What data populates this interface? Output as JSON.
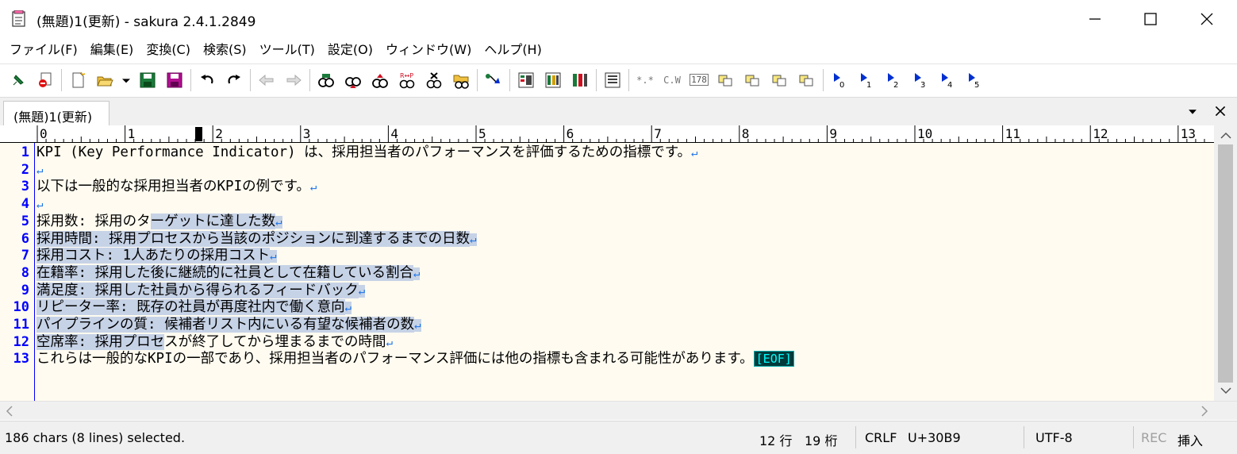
{
  "window": {
    "title": "(無題)1(更新) - sakura 2.4.1.2849"
  },
  "menu": [
    {
      "label": "ファイル(F)"
    },
    {
      "label": "編集(E)"
    },
    {
      "label": "変換(C)"
    },
    {
      "label": "検索(S)"
    },
    {
      "label": "ツール(T)"
    },
    {
      "label": "設定(O)"
    },
    {
      "label": "ウィンドウ(W)"
    },
    {
      "label": "ヘルプ(H)"
    }
  ],
  "toolbar": {
    "icons": [
      "pin-icon",
      "close-file-icon",
      "new-file-icon",
      "open-folder-icon",
      "dropdown-icon",
      "save-icon",
      "save-all-icon",
      "undo-icon",
      "redo-icon",
      "jump-back-icon",
      "jump-forward-icon",
      "search-icon",
      "search-prev-icon",
      "search-next-icon",
      "replace-icon",
      "clear-mark-icon",
      "grep-icon",
      "jump-line-icon",
      "outline-icon",
      "settings-icon",
      "tag-icon",
      "compare-icon",
      "lower-case-icon",
      "upper-case-icon",
      "char-code-icon",
      "convert1-icon",
      "convert2-icon",
      "convert3-icon",
      "convert4-icon"
    ],
    "labels_small": {
      "asterisk": "*.*",
      "cw": "C.W",
      "num": "178"
    },
    "macros": [
      "0",
      "1",
      "2",
      "3",
      "4",
      "5"
    ]
  },
  "tab": {
    "label": "(無題)1(更新)"
  },
  "ruler": {
    "numbers": [
      "0",
      "1",
      "2",
      "3",
      "4",
      "5",
      "6",
      "7",
      "8",
      "9",
      "10",
      "11",
      "12",
      "13"
    ]
  },
  "lines": [
    {
      "num": "1",
      "text": "KPI (Key Performance Indicator) は、採用担当者のパフォーマンスを評価するための指標です。",
      "sel": "",
      "end": "↵"
    },
    {
      "num": "2",
      "text": "",
      "sel": "",
      "end": "↵"
    },
    {
      "num": "3",
      "text": "以下は一般的な採用担当者のKPIの例です。",
      "sel": "",
      "end": "↵"
    },
    {
      "num": "4",
      "text": "",
      "sel": "",
      "end": "↵"
    },
    {
      "num": "5",
      "text": "採用数: 採用のタ",
      "sel": "ーゲットに達した数",
      "end": "↵"
    },
    {
      "num": "6",
      "text": "",
      "sel": "採用時間: 採用プロセスから当該のポジションに到達するまでの日数",
      "end": "↵"
    },
    {
      "num": "7",
      "text": "",
      "sel": "採用コスト: 1人あたりの採用コスト",
      "end": "↵"
    },
    {
      "num": "8",
      "text": "",
      "sel": "在籍率: 採用した後に継続的に社員として在籍している割合",
      "end": "↵"
    },
    {
      "num": "9",
      "text": "",
      "sel": "満足度: 採用した社員から得られるフィードバック",
      "end": "↵"
    },
    {
      "num": "10",
      "text": "",
      "sel": "リピーター率: 既存の社員が再度社内で働く意向",
      "end": "↵"
    },
    {
      "num": "11",
      "text": "",
      "sel": "パイプラインの質: 候補者リスト内にいる有望な候補者の数",
      "end": "↵"
    },
    {
      "num": "12",
      "text": "",
      "sel": "空席率: 採用プロセ",
      "after": "スが終了してから埋まるまでの時間",
      "end": "↵"
    },
    {
      "num": "13",
      "text": "これらは一般的なKPIの一部であり、採用担当者のパフォーマンス評価には他の指標も含まれる可能性があります。",
      "sel": "",
      "end": "[EOF]"
    }
  ],
  "status": {
    "selection": "186 chars (8 lines) selected.",
    "row": "12 行",
    "col": "19 桁",
    "eol": "CRLF",
    "code": "U+30B9",
    "encoding": "UTF-8",
    "rec": "REC",
    "mode": "挿入"
  }
}
